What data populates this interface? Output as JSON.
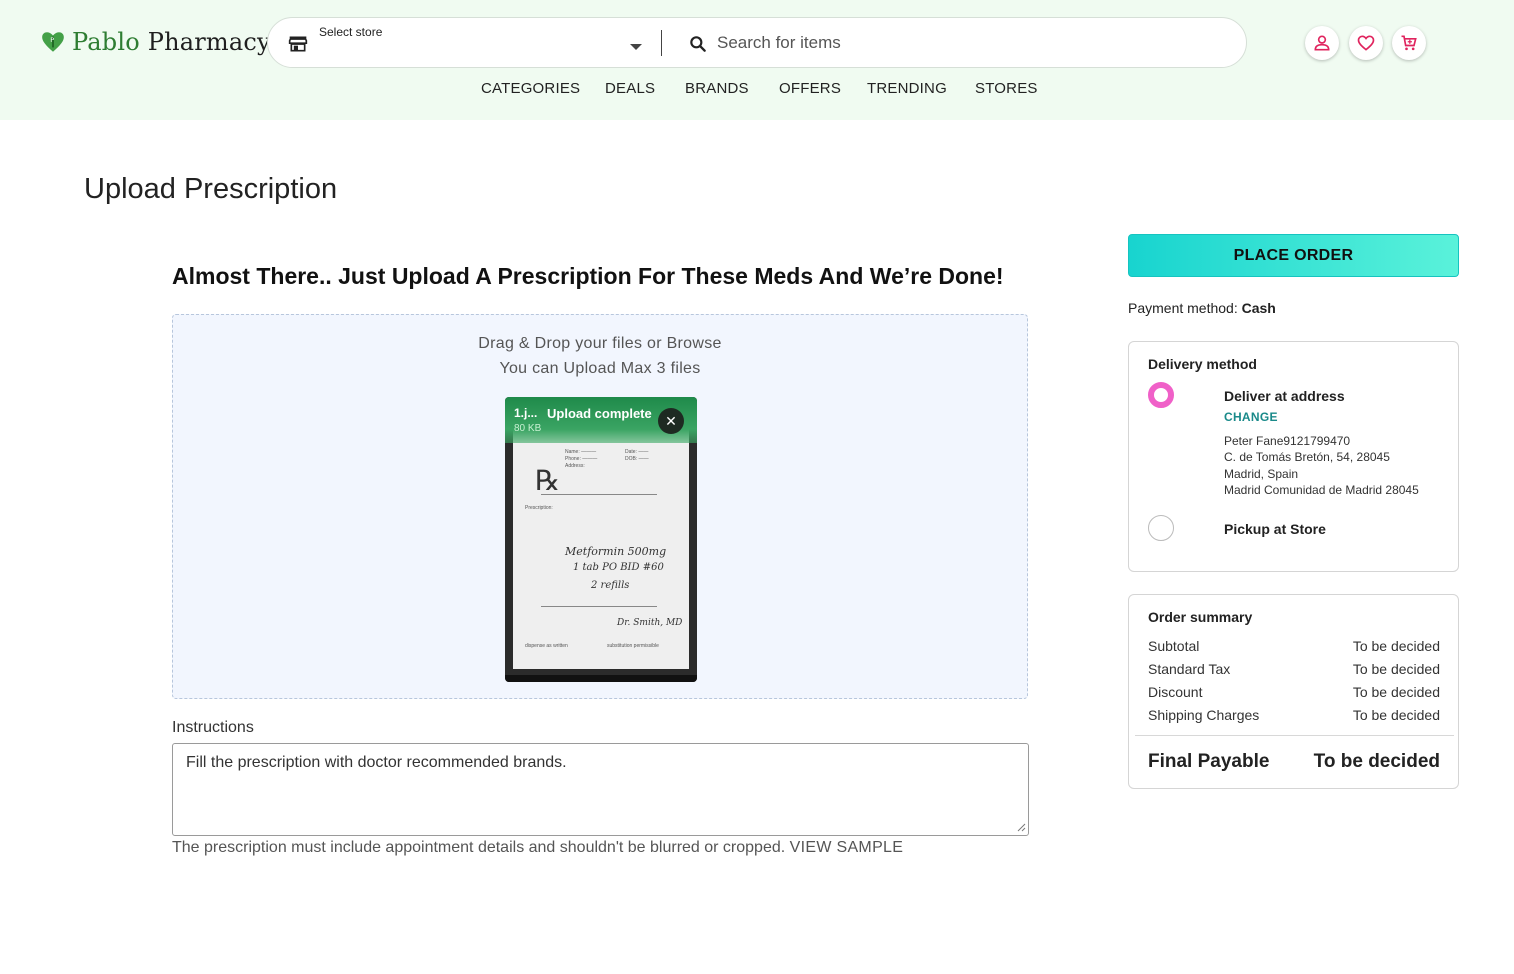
{
  "header": {
    "logo_first": "Pablo",
    "logo_second": "Pharmacy",
    "store_label": "Select store",
    "search_placeholder": "Search for items",
    "nav": [
      "CATEGORIES",
      "DEALS",
      "BRANDS",
      "OFFERS",
      "TRENDING",
      "STORES"
    ],
    "icons": [
      "account-icon",
      "heart-icon",
      "cart-icon"
    ]
  },
  "main": {
    "title": "Upload Prescription",
    "subtitle": "Almost There.. Just Upload A Prescription For These Meds And We’re Done!",
    "dropzone": {
      "line1": "Drag & Drop your files or Browse",
      "line2": "You can Upload Max 3 files"
    },
    "upload": {
      "filename": "1.j...",
      "status": "Upload complete",
      "size": "80 KB"
    },
    "instructions": {
      "label": "Instructions",
      "value": "Fill the prescription with doctor recommended brands."
    },
    "note": "The prescription must include appointment details and shouldn't be blurred or cropped.",
    "view_sample": "VIEW SAMPLE"
  },
  "sidebar": {
    "place_order": "PLACE ORDER",
    "payment_label": "Payment method:",
    "payment_value": "Cash",
    "delivery": {
      "title": "Delivery method",
      "option1": "Deliver at address",
      "change": "CHANGE",
      "address": [
        "Peter Fane9121799470",
        "C. de Tomás Bretón, 54, 28045",
        "Madrid, Spain",
        "Madrid Comunidad de Madrid 28045"
      ],
      "option2": "Pickup at Store"
    },
    "summary": {
      "title": "Order summary",
      "rows": [
        {
          "label": "Subtotal",
          "value": "To be decided"
        },
        {
          "label": "Standard Tax",
          "value": "To be decided"
        },
        {
          "label": "Discount",
          "value": "To be decided"
        },
        {
          "label": "Shipping Charges",
          "value": "To be decided"
        }
      ],
      "final_label": "Final Payable",
      "final_value": "To be decided"
    }
  },
  "colors": {
    "header_bg": "#f0fbf1",
    "brand_green": "#2e7d32",
    "accent_teal": "#18d4cf",
    "radio_pink": "#f060c8",
    "icon_red": "#e0245e",
    "link_teal": "#1a8a8a"
  }
}
